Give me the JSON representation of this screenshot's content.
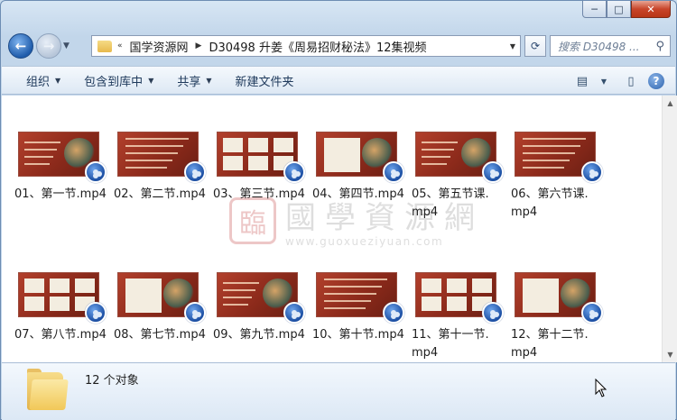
{
  "window": {
    "caption_buttons": [
      "─",
      "□",
      "✕"
    ]
  },
  "nav": {
    "back_glyph": "←",
    "forward_glyph": "→",
    "history_glyph": "▼",
    "breadcrumb_overflow": "«",
    "breadcrumbs": [
      "国学资源网",
      "D30498 升姜《周易招财秘法》12集视频"
    ],
    "dropdown_glyph": "▼",
    "refresh_glyph": "⟳",
    "search_placeholder": "搜索 D30498 ...",
    "search_glyph": "⚲"
  },
  "toolbar": {
    "items": [
      {
        "label": "组织",
        "has_arrow": true
      },
      {
        "label": "包含到库中",
        "has_arrow": true
      },
      {
        "label": "共享",
        "has_arrow": true
      },
      {
        "label": "新建文件夹",
        "has_arrow": false
      }
    ],
    "arrow_glyph": "▼",
    "view_glyph": "▤",
    "pane_glyph": "▯",
    "help_glyph": "?"
  },
  "watermark": {
    "seal_char": "臨",
    "text": "國學資源網",
    "url": "www.guoxueziyuan.com"
  },
  "files": [
    {
      "name": "01、第一节.mp4"
    },
    {
      "name": "02、第二节.mp4"
    },
    {
      "name": "03、第三节.mp4"
    },
    {
      "name": "04、第四节.mp4"
    },
    {
      "name": "05、第五节课.\nmp4"
    },
    {
      "name": "06、第六节课.\nmp4"
    },
    {
      "name": "07、第八节.mp4"
    },
    {
      "name": "08、第七节.mp4"
    },
    {
      "name": "09、第九节.mp4"
    },
    {
      "name": "10、第十节.mp4"
    },
    {
      "name": "11、第十一节.\nmp4"
    },
    {
      "name": "12、第十二节.\nmp4"
    }
  ],
  "details": {
    "count_text": "12 个对象"
  },
  "colors": {
    "accent": "#1e395b",
    "thumb_red": "#8c2a1b"
  }
}
